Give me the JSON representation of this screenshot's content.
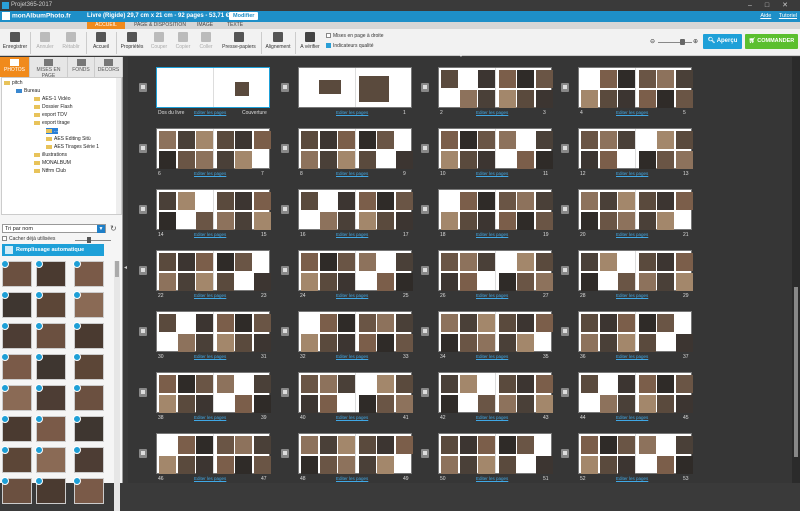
{
  "window": {
    "app_title": "Projet365-2017",
    "controls": [
      "–",
      "□",
      "✕"
    ]
  },
  "brand": {
    "logo": "monAlbumPhoto.fr",
    "product_desc": "Livre (Rigide) 29,7 cm x 21 cm - 92 pages - 53,71 €",
    "modify_label": "Modifier",
    "help_label": "Aide",
    "tutorial_label": "Tutoriel"
  },
  "menu_tabs": [
    "ACCUEIL",
    "PAGE & DISPOSITION",
    "IMAGE",
    "TEXTE"
  ],
  "toolbar": {
    "save": "Enregistrer",
    "undo": "Annuler",
    "redo": "Rétablir",
    "home": "Accueil",
    "properties": "Propriétés",
    "cut": "Couper",
    "copy": "Copier",
    "paste": "Coller",
    "clipboard": "Presse-papiers",
    "align": "Alignement",
    "verify": "A vérifier",
    "opt_right_page": "Mises en page à droite",
    "opt_quality": "Indicateurs qualité",
    "preview": "Aperçu",
    "order": "COMMANDER"
  },
  "left_panel": {
    "tabs": [
      "PHOTOS",
      "MISES EN PAGE",
      "FONDS",
      "DECORS"
    ],
    "tree": [
      "pitch",
      "Bureau",
      "AES-1 Vidéo",
      "Dossier Flash",
      "export TDV",
      "export tirage",
      "...",
      "AES Editing Sitü",
      "AES Tirages Série 1",
      "illustrations",
      "MONALBUM",
      "Ntfrm Club"
    ],
    "sort": "Tri par nom",
    "hide_used": "Cacher déjà utilisées",
    "autofill": "Remplissage automatique"
  },
  "spreads": [
    {
      "left_num": "Dos du livre",
      "right_num": "Couverture",
      "edit": "Editer les pages"
    },
    {
      "left_num": "",
      "right_num": "1",
      "edit": "Editer les pages"
    },
    {
      "left_num": "2",
      "right_num": "3",
      "edit": "Editer les pages"
    },
    {
      "left_num": "4",
      "right_num": "5",
      "edit": "Editer les pages"
    },
    {
      "left_num": "6",
      "right_num": "7",
      "edit": "Editer les pages"
    },
    {
      "left_num": "8",
      "right_num": "9",
      "edit": "Editer les pages"
    },
    {
      "left_num": "10",
      "right_num": "11",
      "edit": "Editer les pages"
    },
    {
      "left_num": "12",
      "right_num": "13",
      "edit": "Editer les pages"
    },
    {
      "left_num": "14",
      "right_num": "15",
      "edit": "Editer les pages"
    },
    {
      "left_num": "16",
      "right_num": "17",
      "edit": "Editer les pages"
    },
    {
      "left_num": "18",
      "right_num": "19",
      "edit": "Editer les pages"
    },
    {
      "left_num": "20",
      "right_num": "21",
      "edit": "Editer les pages"
    },
    {
      "left_num": "22",
      "right_num": "23",
      "edit": "Editer les pages"
    },
    {
      "left_num": "24",
      "right_num": "25",
      "edit": "Editer les pages"
    },
    {
      "left_num": "26",
      "right_num": "27",
      "edit": "Editer les pages"
    },
    {
      "left_num": "28",
      "right_num": "29",
      "edit": "Editer les pages"
    },
    {
      "left_num": "30",
      "right_num": "31",
      "edit": "Editer les pages"
    },
    {
      "left_num": "32",
      "right_num": "33",
      "edit": "Editer les pages"
    },
    {
      "left_num": "34",
      "right_num": "35",
      "edit": "Editer les pages"
    },
    {
      "left_num": "36",
      "right_num": "37",
      "edit": "Editer les pages"
    },
    {
      "left_num": "38",
      "right_num": "39",
      "edit": "Editer les pages"
    },
    {
      "left_num": "40",
      "right_num": "41",
      "edit": "Editer les pages"
    },
    {
      "left_num": "42",
      "right_num": "43",
      "edit": "Editer les pages"
    },
    {
      "left_num": "44",
      "right_num": "45",
      "edit": "Editer les pages"
    },
    {
      "left_num": "46",
      "right_num": "47",
      "edit": "Editer les pages"
    },
    {
      "left_num": "48",
      "right_num": "49",
      "edit": "Editer les pages"
    },
    {
      "left_num": "50",
      "right_num": "51",
      "edit": "Editer les pages"
    },
    {
      "left_num": "52",
      "right_num": "53",
      "edit": "Editer les pages"
    }
  ],
  "colors": {
    "brand_blue": "#1e8fc8",
    "accent_orange": "#f08a1c",
    "order_green": "#5bbf2f",
    "preview_blue": "#1ea0d8"
  }
}
